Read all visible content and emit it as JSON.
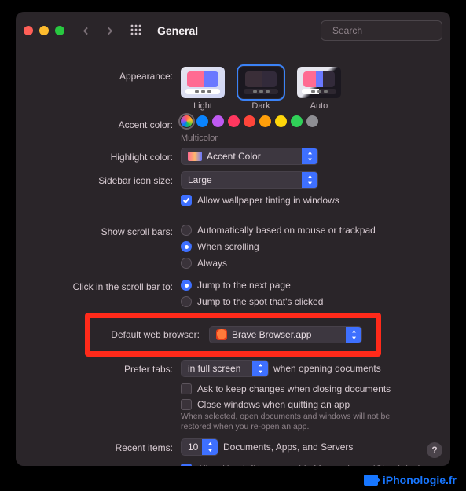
{
  "title": "General",
  "search": {
    "placeholder": "Search"
  },
  "appearance": {
    "label": "Appearance:",
    "options": [
      "Light",
      "Dark",
      "Auto"
    ],
    "selected": "Dark"
  },
  "accent": {
    "label": "Accent color:",
    "value": "Multicolor"
  },
  "highlight": {
    "label": "Highlight color:",
    "value": "Accent Color"
  },
  "sidebar_icon": {
    "label": "Sidebar icon size:",
    "value": "Large"
  },
  "wallpaper_tinting": {
    "label": "Allow wallpaper tinting in windows",
    "checked": true
  },
  "scrollbars": {
    "label": "Show scroll bars:",
    "options": [
      "Automatically based on mouse or trackpad",
      "When scrolling",
      "Always"
    ],
    "selected": "When scrolling"
  },
  "click_scroll": {
    "label": "Click in the scroll bar to:",
    "options": [
      "Jump to the next page",
      "Jump to the spot that's clicked"
    ],
    "selected": "Jump to the next page"
  },
  "default_browser": {
    "label": "Default web browser:",
    "value": "Brave Browser.app"
  },
  "prefer_tabs": {
    "label": "Prefer tabs:",
    "value": "in full screen",
    "suffix": "when opening documents"
  },
  "ask_keep_changes": {
    "label": "Ask to keep changes when closing documents",
    "checked": false
  },
  "close_windows_quit": {
    "label": "Close windows when quitting an app",
    "checked": false,
    "hint": "When selected, open documents and windows will not be restored when you re-open an app."
  },
  "recent_items": {
    "label": "Recent items:",
    "value": "10",
    "suffix": "Documents, Apps, and Servers"
  },
  "allow_handoff": {
    "label": "Allow Handoff between this Mac and your iCloud devices",
    "checked": true
  },
  "watermark": "iPhonologie.fr"
}
